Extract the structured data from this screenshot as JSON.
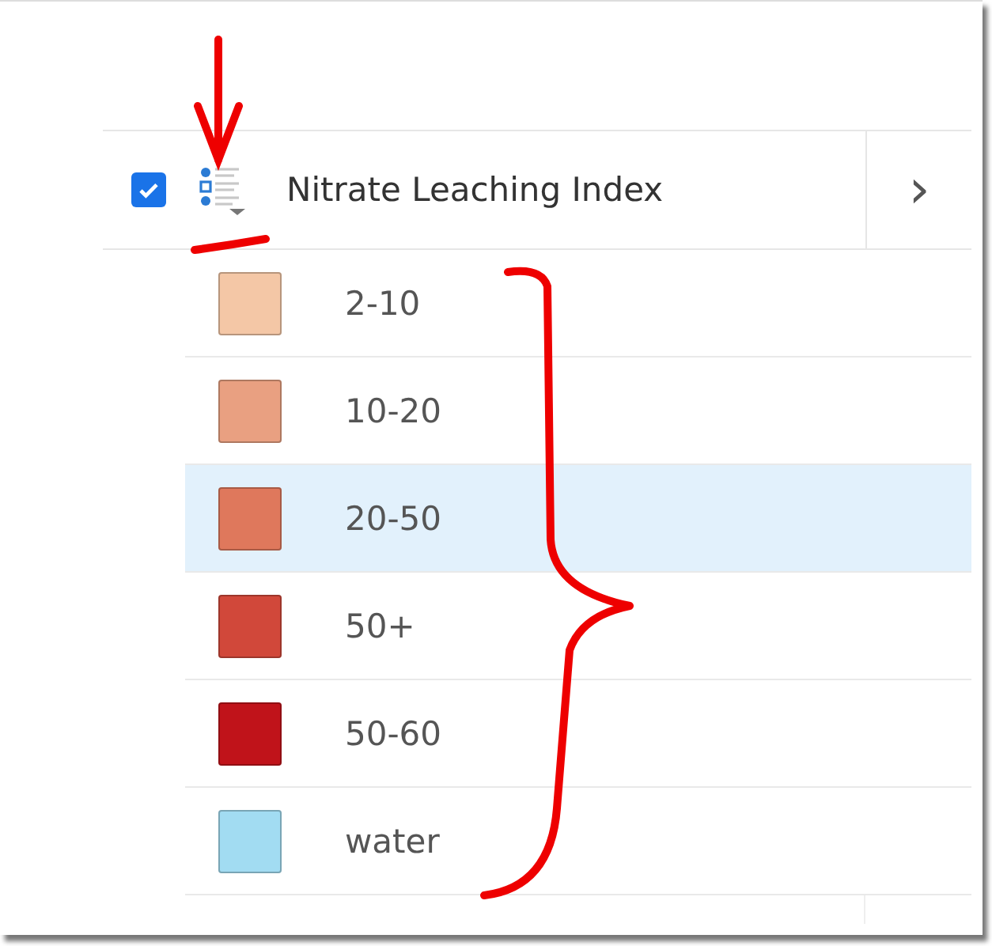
{
  "layer": {
    "title": "Nitrate Leaching Index",
    "checked": true,
    "chevron": "›"
  },
  "legend": [
    {
      "label": "2-10",
      "color": "#f4c7a6",
      "selected": false
    },
    {
      "label": "10-20",
      "color": "#e9a081",
      "selected": false
    },
    {
      "label": "20-50",
      "color": "#df785c",
      "selected": true
    },
    {
      "label": "50+",
      "color": "#d1483a",
      "selected": false
    },
    {
      "label": "50-60",
      "color": "#c0131a",
      "selected": false
    },
    {
      "label": "water",
      "color": "#a2dcf2",
      "selected": false
    }
  ]
}
